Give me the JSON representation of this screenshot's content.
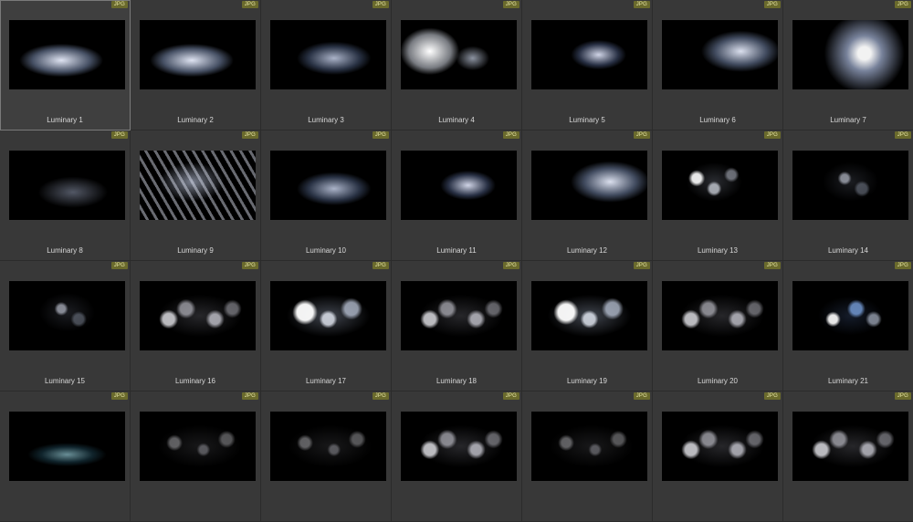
{
  "badge_text": "JPG",
  "selected_index": 0,
  "items": [
    {
      "label": "Luminary 1",
      "style": "blob-left"
    },
    {
      "label": "Luminary 2",
      "style": "blob-left"
    },
    {
      "label": "Luminary 3",
      "style": "blob-mid"
    },
    {
      "label": "Luminary 4",
      "style": "bright-left"
    },
    {
      "label": "Luminary 5",
      "style": "shards"
    },
    {
      "label": "Luminary 6",
      "style": "blob-right"
    },
    {
      "label": "Luminary 7",
      "style": "ring"
    },
    {
      "label": "Luminary 8",
      "style": "faint"
    },
    {
      "label": "Luminary 9",
      "style": "streaks"
    },
    {
      "label": "Luminary 10",
      "style": "blob-mid"
    },
    {
      "label": "Luminary 11",
      "style": "shards"
    },
    {
      "label": "Luminary 12",
      "style": "blob-right"
    },
    {
      "label": "Luminary 13",
      "style": "bokeh-left"
    },
    {
      "label": "Luminary 14",
      "style": "bokeh-faint"
    },
    {
      "label": "Luminary 15",
      "style": "bokeh-faint"
    },
    {
      "label": "Luminary 16",
      "style": "bokeh-mid"
    },
    {
      "label": "Luminary 17",
      "style": "bokeh-bright"
    },
    {
      "label": "Luminary 18",
      "style": "bokeh-mid"
    },
    {
      "label": "Luminary 19",
      "style": "bokeh-bright"
    },
    {
      "label": "Luminary 20",
      "style": "bokeh-mid"
    },
    {
      "label": "Luminary 21",
      "style": "bokeh-blue"
    },
    {
      "label": "",
      "style": "bokeh-teal"
    },
    {
      "label": "",
      "style": "bokeh-dark"
    },
    {
      "label": "",
      "style": "bokeh-dark"
    },
    {
      "label": "",
      "style": "bokeh-mid"
    },
    {
      "label": "",
      "style": "bokeh-dark"
    },
    {
      "label": "",
      "style": "bokeh-mid"
    },
    {
      "label": "",
      "style": "bokeh-mid"
    }
  ]
}
